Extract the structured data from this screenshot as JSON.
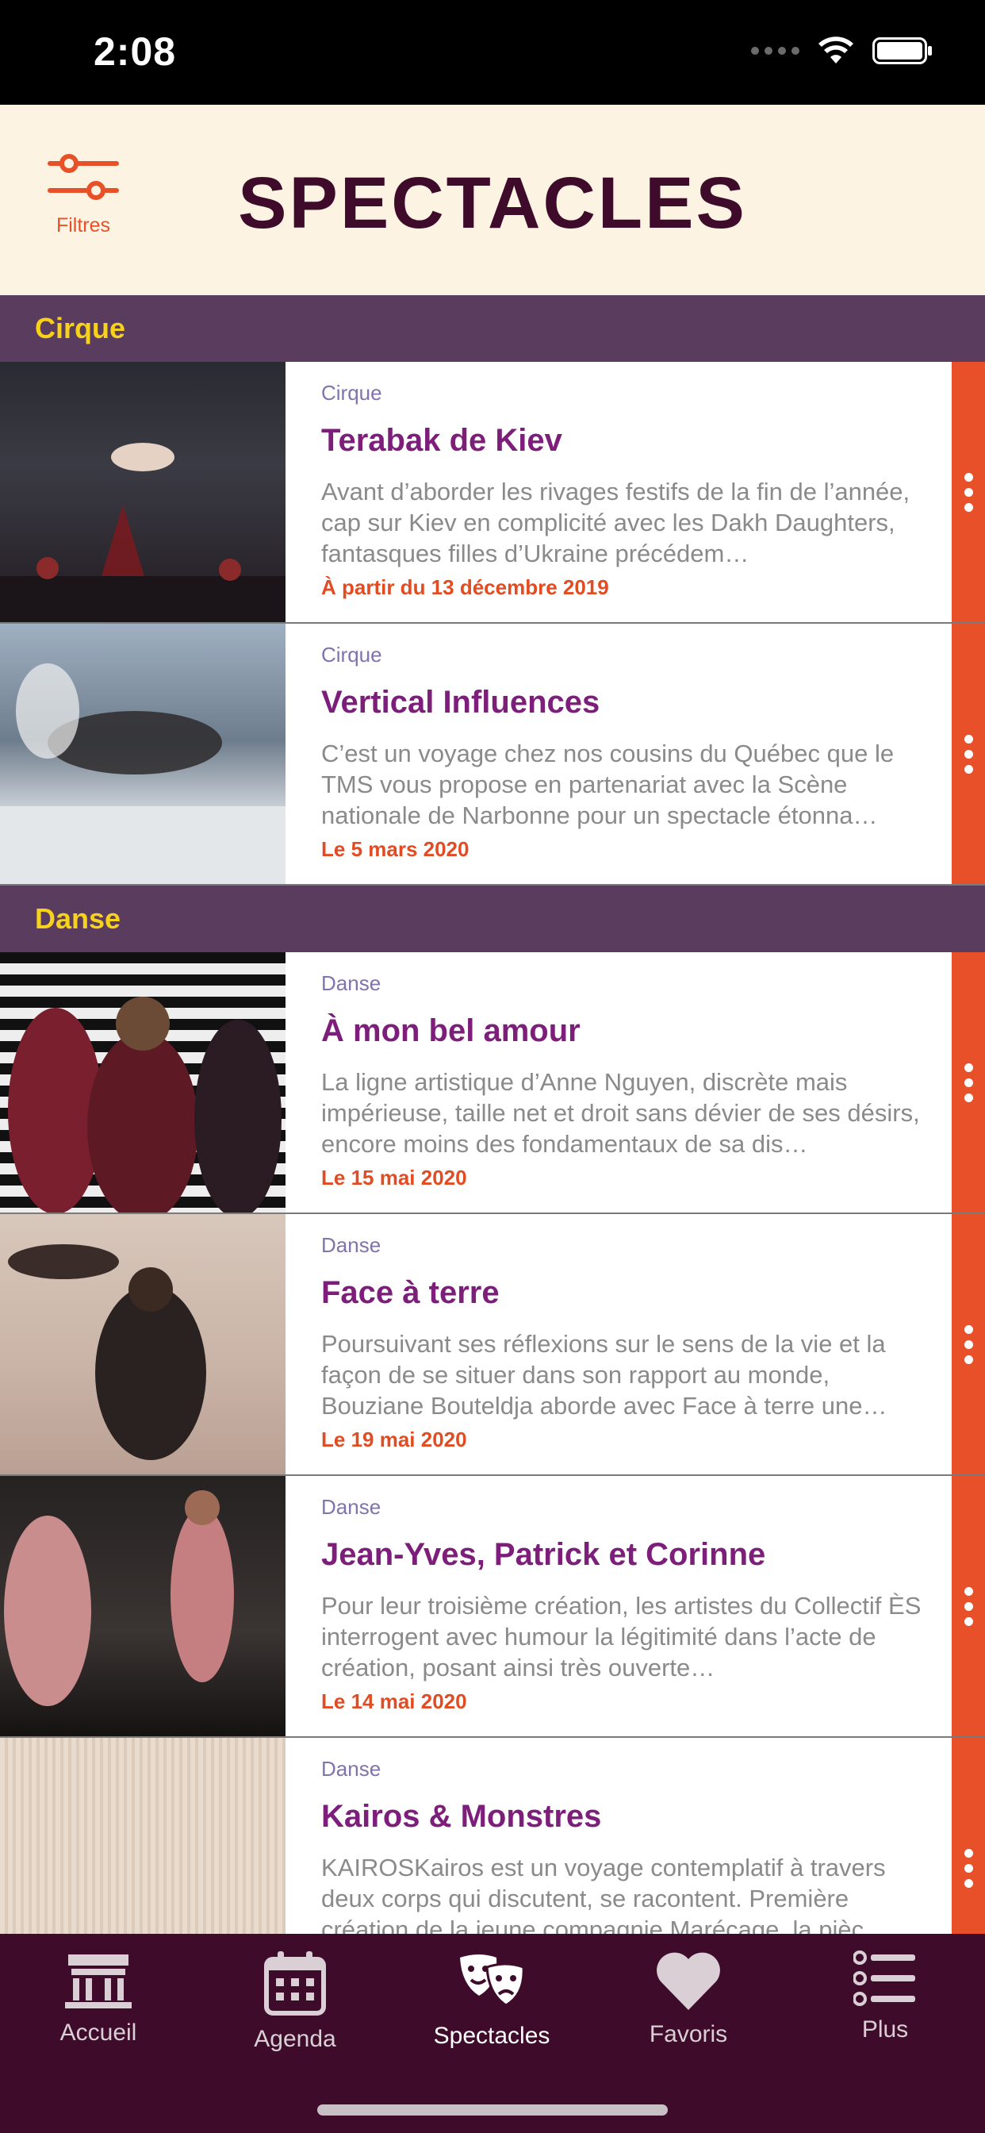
{
  "status_bar": {
    "time": "2:08"
  },
  "header": {
    "filter_label": "Filtres",
    "title": "SPECTACLES"
  },
  "sections": [
    {
      "name": "Cirque",
      "items": [
        {
          "category": "Cirque",
          "title": "Terabak de Kiev",
          "description": "Avant d’aborder les rivages festifs de la fin de l’année, cap sur Kiev en complicité avec les Dakh Daughters, fantasques filles d’Ukraine précédem…",
          "date": "À partir du 13 décembre 2019"
        },
        {
          "category": "Cirque",
          "title": "Vertical Influences",
          "description": "C’est un voyage chez nos cousins du Québec que le TMS vous propose en partenariat avec la Scène nationale de Narbonne pour un spectacle étonna…",
          "date": "Le 5 mars 2020"
        }
      ]
    },
    {
      "name": "Danse",
      "items": [
        {
          "category": "Danse",
          "title": "À mon bel amour",
          "description": "La ligne artistique d’Anne Nguyen, discrète mais impérieuse, taille net et droit sans dévier de ses désirs, encore moins des fondamentaux de sa dis…",
          "date": "Le 15 mai 2020"
        },
        {
          "category": "Danse",
          "title": "Face à terre",
          "description": "Poursuivant ses réflexions sur le sens de la vie et la façon de se situer dans son rapport au monde, Bouziane Bouteldja aborde avec Face à terre une…",
          "date": "Le 19 mai 2020"
        },
        {
          "category": "Danse",
          "title": "Jean-Yves, Patrick et Corinne",
          "description": "Pour leur troisième création, les artistes du Collectif ÈS interrogent avec humour la légitimité dans l’acte de création, posant ainsi très ouverte…",
          "date": "Le 14 mai 2020"
        },
        {
          "category": "Danse",
          "title": "Kairos & Monstres",
          "description": "KAIROSKairos est un voyage contemplatif à travers deux corps qui discutent, se racontent. Première création de la jeune compagnie Marécage, la pièc…",
          "date": ""
        }
      ]
    }
  ],
  "tabs": [
    {
      "label": "Accueil",
      "icon": "theater-building-icon",
      "active": false
    },
    {
      "label": "Agenda",
      "icon": "calendar-icon",
      "active": false
    },
    {
      "label": "Spectacles",
      "icon": "theater-masks-icon",
      "active": true
    },
    {
      "label": "Favoris",
      "icon": "heart-icon",
      "active": false
    },
    {
      "label": "Plus",
      "icon": "list-icon",
      "active": false
    }
  ],
  "colors": {
    "header_bg": "#fdf3e3",
    "title": "#3e0b2b",
    "accent": "#e8502a",
    "section_bg": "#5a3c5e",
    "section_text": "#f7d21c",
    "item_title": "#7d1e7b",
    "tab_bar_bg": "#3e0b2b"
  }
}
